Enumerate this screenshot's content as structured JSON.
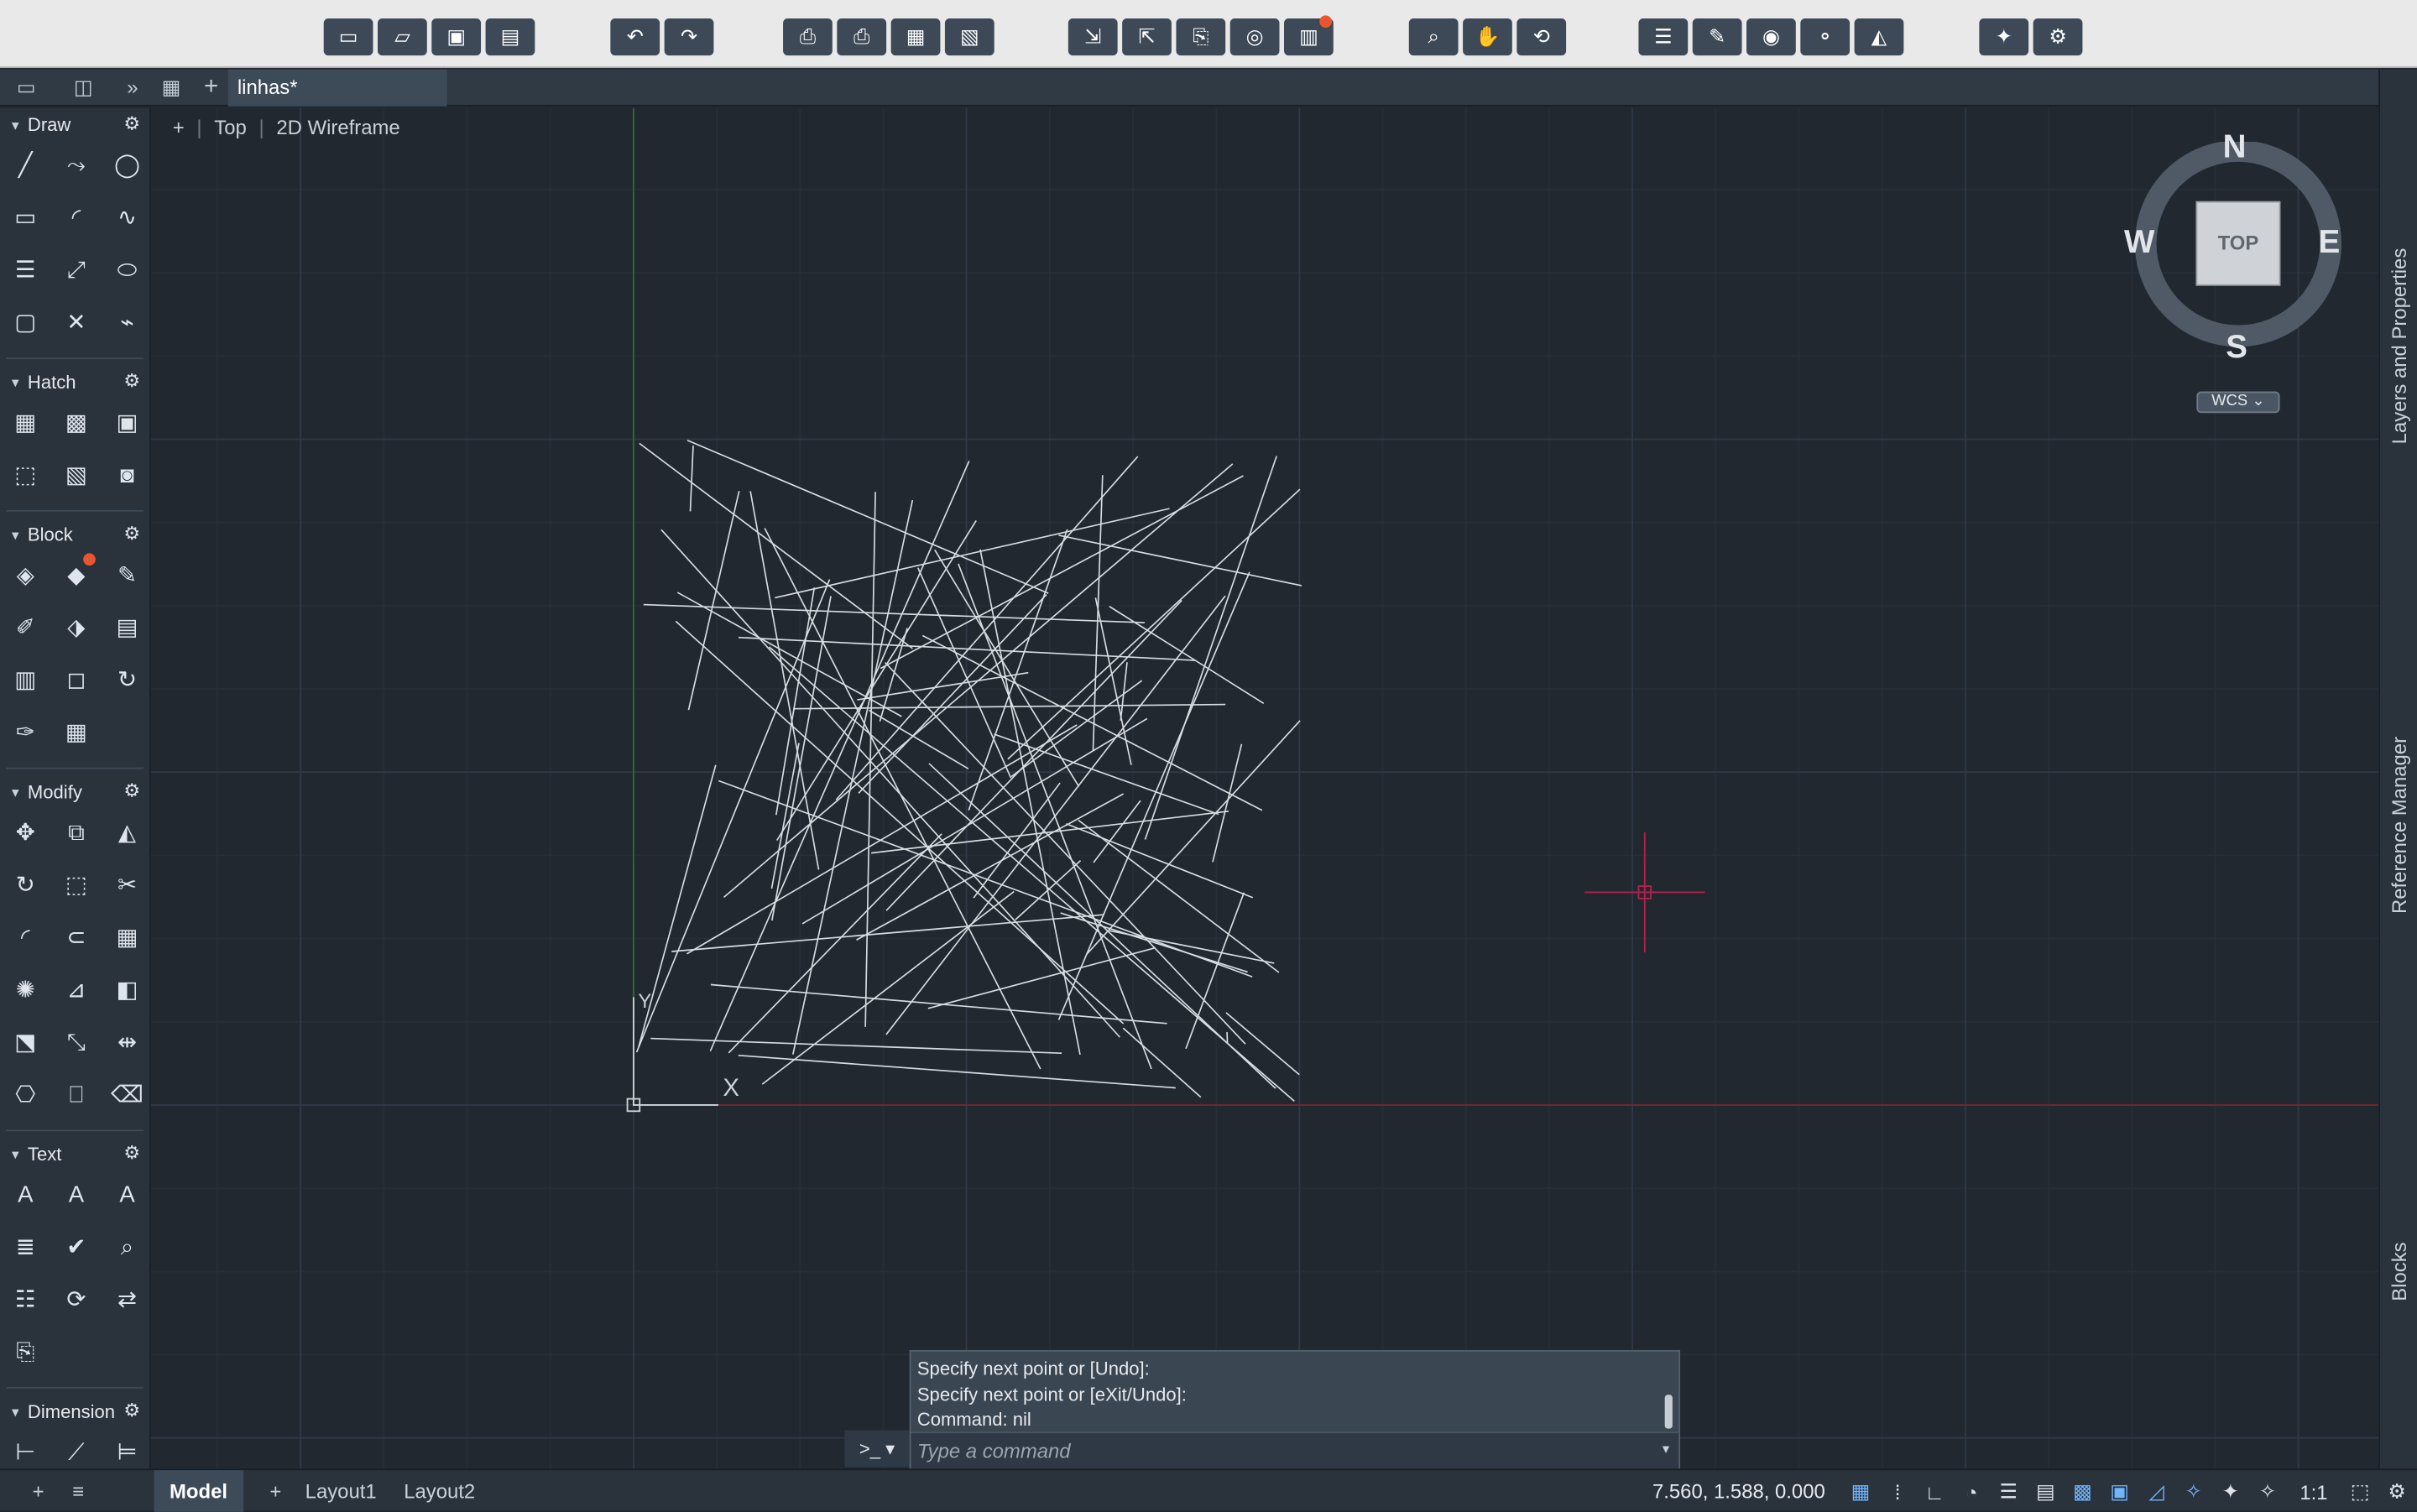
{
  "toolbar": {
    "groups": [
      {
        "name": "file",
        "buttons": [
          "new-file-icon",
          "open-folder-icon",
          "save-icon",
          "save-as-icon"
        ]
      },
      {
        "name": "history",
        "buttons": [
          "undo-icon",
          "redo-icon"
        ]
      },
      {
        "name": "print",
        "buttons": [
          "plot-icon",
          "batch-plot-icon",
          "publish-icon",
          "page-setup-icon"
        ]
      },
      {
        "name": "share",
        "buttons": [
          "import-icon",
          "export-icon",
          "attach-icon",
          "web-share-icon",
          "notification-icon"
        ]
      },
      {
        "name": "navigate",
        "buttons": [
          "zoom-window-icon",
          "pan-hand-icon",
          "orbit-icon"
        ]
      },
      {
        "name": "properties",
        "buttons": [
          "properties-icon",
          "match-properties-icon",
          "layer-icon",
          "layer-states-icon",
          "isolate-icon"
        ]
      },
      {
        "name": "extras",
        "buttons": [
          "capture-icon",
          "render-icon"
        ]
      }
    ]
  },
  "tabs": {
    "document": "linhas*"
  },
  "viewport": {
    "view_control": "+",
    "view_name": "Top",
    "visual_style": "2D Wireframe"
  },
  "viewcube": {
    "north": "N",
    "south": "S",
    "east": "E",
    "west": "W",
    "face": "TOP",
    "ucs": "WCS"
  },
  "ucs_icon": {
    "y_label": "Y",
    "x_label": "X"
  },
  "panels": [
    {
      "title": "Draw",
      "icons": [
        "line-icon",
        "polyline-icon",
        "circle-icon",
        "rectangle-icon",
        "arc-icon",
        "spline-icon",
        "multiline-icon",
        "construction-line-icon",
        "ellipse-icon",
        "rounded-rectangle-icon",
        "ray-icon",
        "revcloud-icon"
      ]
    },
    {
      "title": "Hatch",
      "icons": [
        "hatch-icon",
        "gradient-icon",
        "boundary-icon",
        "region-icon",
        "hatch-pattern-icon",
        "wipeout-icon"
      ]
    },
    {
      "title": "Block",
      "icons": [
        "create-block-icon",
        "insert-block-icon",
        "edit-block-icon",
        "define-attribute-icon",
        "attribute-tag-icon",
        "block-palette-icon",
        "write-block-icon",
        "base-point-icon",
        "block-refresh-icon",
        "attribute-edit-icon",
        "block-table-icon"
      ]
    },
    {
      "title": "Modify",
      "icons": [
        "move-icon",
        "copy-icon",
        "mirror-icon",
        "rotate-icon",
        "stretch-icon",
        "trim-icon",
        "fillet-icon",
        "offset-icon",
        "array-icon",
        "explode-icon",
        "align-icon",
        "draw-order-icon",
        "scale-icon",
        "break-icon",
        "join-icon",
        "edit-polyline-icon",
        "edit-spline-icon",
        "erase-icon"
      ]
    },
    {
      "title": "Text",
      "icons": [
        "multiline-text-icon",
        "single-line-text-icon",
        "annotative-text-icon",
        "text-style-icon",
        "spell-check-icon",
        "find-text-icon",
        "text-frame-icon",
        "update-fields-icon",
        "pdf-to-text-icon",
        "pdf-import-icon"
      ]
    },
    {
      "title": "Dimension",
      "icons": [
        "linear-dimension-icon",
        "aligned-dimension-icon",
        "baseline-dimension-icon"
      ]
    }
  ],
  "right_panels": [
    "Layers and Properties",
    "Reference Manager",
    "Blocks"
  ],
  "command_line": {
    "history": [
      "Specify next point or [Undo]:",
      "Specify next point or [eXit/Undo]:",
      "Command: nil"
    ],
    "placeholder": "Type a command",
    "prompt": ">_"
  },
  "status_bar": {
    "layout_tabs": [
      "Model",
      "Layout1",
      "Layout2"
    ],
    "add_tab": "+",
    "coordinates": "7.560, 1.588, 0.000",
    "scale": "1:1",
    "toggles": [
      "grid-icon",
      "snap-icon",
      "ortho-icon",
      "polar-icon",
      "osnap-icon",
      "lineweight-icon",
      "transparency-icon",
      "selection-cycling-icon",
      "dynamic-ucs-icon",
      "quick-properties-icon",
      "annotation-visibility-icon",
      "auto-scale-icon",
      "annotation-scale-icon",
      "workspace-icon",
      "settings-icon"
    ]
  }
}
